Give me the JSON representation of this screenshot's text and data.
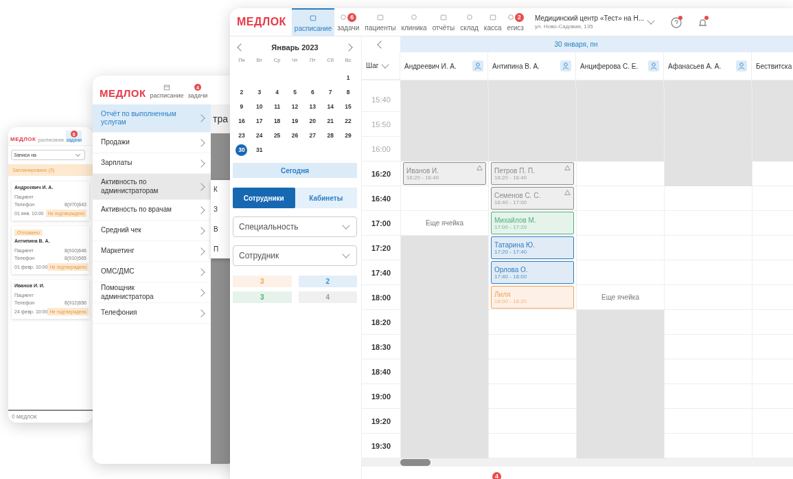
{
  "phone_window": {
    "logo": "МЕДЛОК",
    "tabs": [
      {
        "label": "расписание",
        "selected": false
      },
      {
        "label": "задачи",
        "selected": true,
        "badge": "6"
      }
    ],
    "filter": {
      "value": "Записи на"
    },
    "group": {
      "title": "Запланировано (3)"
    },
    "cards": [
      {
        "name": "Андреевич И. А.",
        "rows": [
          {
            "label": "Пациент"
          },
          {
            "label": "Телефон",
            "value": "8(970)643"
          }
        ],
        "date": "01 янв. 10:00",
        "status": "Не подтверждено"
      },
      {
        "name": "Антипина В. А.",
        "tag": "Отложено",
        "rows": [
          {
            "label": "Пациент",
            "value": "8(910)646"
          },
          {
            "label": "Телефон",
            "value": "8(910)565"
          }
        ],
        "date": "01 февр. 10:00",
        "status": "Не подтверждено"
      },
      {
        "name": "Иванов И. И.",
        "rows": [
          {
            "label": "Пациент"
          },
          {
            "label": "Телефон",
            "value": "8(912)656"
          }
        ],
        "date": "24 февр. 10:00",
        "status": "Не подтверждено"
      }
    ],
    "footer": "© МЕДЛОК"
  },
  "tablet_window": {
    "logo": "МЕДЛОК",
    "tabs": [
      {
        "label": "расписание",
        "selected": false
      },
      {
        "label": "задачи",
        "selected": false,
        "badge": "4"
      }
    ],
    "menu": [
      {
        "label": "Отчёт по выполненным услугам",
        "selected": true,
        "hovered": false
      },
      {
        "label": "Продажи",
        "selected": false,
        "hovered": false
      },
      {
        "label": "Зарплаты",
        "selected": false,
        "hovered": false
      },
      {
        "label": "Активность по администраторам",
        "selected": false,
        "hovered": true
      },
      {
        "label": "Активность по врачам",
        "selected": false,
        "hovered": false
      },
      {
        "label": "Средний чек",
        "selected": false,
        "hovered": false
      },
      {
        "label": "Маркетинг",
        "selected": false,
        "hovered": false
      },
      {
        "label": "ОМС/ДМС",
        "selected": false,
        "hovered": false
      },
      {
        "label": "Помощник администратора",
        "selected": false,
        "hovered": false
      },
      {
        "label": "Телефония",
        "selected": false,
        "hovered": false
      }
    ],
    "page_title": "тра",
    "submenu": [
      "К",
      "З",
      "В",
      "П"
    ]
  },
  "main_window": {
    "logo": "МЕДЛОК",
    "tabs": [
      {
        "label": "расписание",
        "selected": true
      },
      {
        "label": "задачи",
        "selected": false,
        "badge": "6"
      },
      {
        "label": "пациенты",
        "selected": false
      },
      {
        "label": "клиника",
        "selected": false
      },
      {
        "label": "отчёты",
        "selected": false
      },
      {
        "label": "склад",
        "selected": false
      },
      {
        "label": "касса",
        "selected": false
      },
      {
        "label": "егисз",
        "selected": false,
        "badge": "2"
      }
    ],
    "clinic": {
      "name": "Медицинский центр «Тест» на Н...",
      "address": "ул. Ново-Садовая, 135"
    },
    "help_alert": true,
    "notification_alert": true,
    "calendar": {
      "month": "Январь 2023",
      "weekdays": [
        "Пн",
        "Вт",
        "Ср",
        "Чт",
        "Пт",
        "Сб",
        "Вс"
      ],
      "weeks": [
        [
          {
            "day": "1",
            "selected": false
          }
        ],
        [
          {
            "day": "2",
            "selected": false
          },
          {
            "day": "3",
            "selected": false
          },
          {
            "day": "4",
            "selected": false
          },
          {
            "day": "5",
            "selected": false
          },
          {
            "day": "6",
            "selected": false
          },
          {
            "day": "7",
            "selected": false
          },
          {
            "day": "8",
            "selected": false
          }
        ],
        [
          {
            "day": "9",
            "selected": false
          },
          {
            "day": "10",
            "selected": false
          },
          {
            "day": "11",
            "selected": false
          },
          {
            "day": "12",
            "selected": false
          },
          {
            "day": "13",
            "selected": false
          },
          {
            "day": "14",
            "selected": false
          },
          {
            "day": "15",
            "selected": false
          }
        ],
        [
          {
            "day": "16",
            "selected": false
          },
          {
            "day": "17",
            "selected": false
          },
          {
            "day": "18",
            "selected": false
          },
          {
            "day": "19",
            "selected": false
          },
          {
            "day": "20",
            "selected": false
          },
          {
            "day": "21",
            "selected": false
          },
          {
            "day": "22",
            "selected": false
          }
        ],
        [
          {
            "day": "23",
            "selected": false
          },
          {
            "day": "24",
            "selected": false
          },
          {
            "day": "25",
            "selected": false
          },
          {
            "day": "26",
            "selected": false
          },
          {
            "day": "27",
            "selected": false
          },
          {
            "day": "28",
            "selected": false
          },
          {
            "day": "29",
            "selected": false
          }
        ],
        [
          {
            "day": "30",
            "selected": true
          },
          {
            "day": "31",
            "selected": false
          }
        ]
      ],
      "today_button": "Сегодня"
    },
    "view_toggle": [
      {
        "label": "Сотрудники",
        "selected": true
      },
      {
        "label": "Кабинеты",
        "selected": false
      }
    ],
    "filters": [
      {
        "placeholder": "Специальность"
      },
      {
        "placeholder": "Сотрудник"
      }
    ],
    "counters": [
      {
        "value": "3",
        "color": "#f0a35e"
      },
      {
        "value": "2",
        "color": "#3d8fd1"
      },
      {
        "value": "3",
        "color": "#4fb07a"
      },
      {
        "value": "4",
        "color": "#9a9a9a"
      }
    ],
    "schedule": {
      "date": "30 января, пн",
      "step_label": "Шаг",
      "doctors": [
        "Андреевич И. А.",
        "Антипина В. А.",
        "Анциферова С. Е.",
        "Афанасьев А. А.",
        "Бествитска"
      ],
      "rows": [
        {
          "time": "15:40",
          "past": true,
          "cells": [
            {
              "kind": "off"
            },
            {
              "kind": "off"
            },
            {
              "kind": "off"
            },
            {
              "kind": "off"
            },
            {
              "kind": "off"
            }
          ]
        },
        {
          "time": "15:50",
          "past": true,
          "cells": [
            {
              "kind": "off"
            },
            {
              "kind": "off"
            },
            {
              "kind": "off"
            },
            {
              "kind": "off"
            },
            {
              "kind": "off"
            }
          ]
        },
        {
          "time": "16:00",
          "past": true,
          "cells": [
            {
              "kind": "off"
            },
            {
              "kind": "off"
            },
            {
              "kind": "off"
            },
            {
              "kind": "off"
            },
            {
              "kind": "off"
            }
          ]
        },
        {
          "time": "16:20",
          "past": false,
          "cells": [
            {
              "kind": "appointment",
              "name": "Иванов И.",
              "time": "16:20 - 16:40",
              "color": "#8c8c8c",
              "warning": true
            },
            {
              "kind": "appointment",
              "name": "Петров П. П.",
              "time": "16:20 - 16:40",
              "color": "#8c8c8c",
              "warning": true
            },
            {
              "kind": "free"
            },
            {
              "kind": "off"
            },
            {
              "kind": "free"
            }
          ]
        },
        {
          "time": "16:40",
          "past": false,
          "cells": [
            {
              "kind": "free"
            },
            {
              "kind": "appointment",
              "name": "Семенов С. С.",
              "time": "16:40 - 17:00",
              "color": "#8c8c8c",
              "warning": true
            },
            {
              "kind": "free"
            },
            {
              "kind": "free"
            },
            {
              "kind": "free"
            }
          ]
        },
        {
          "time": "17:00",
          "past": false,
          "cells": [
            {
              "kind": "note",
              "text": "Еще ячейка"
            },
            {
              "kind": "appointment",
              "name": "Михайлов М.",
              "time": "17:00 - 17:20",
              "color": "#4fb07a",
              "warning": false
            },
            {
              "kind": "free"
            },
            {
              "kind": "free"
            },
            {
              "kind": "free"
            }
          ]
        },
        {
          "time": "17:20",
          "past": false,
          "cells": [
            {
              "kind": "off"
            },
            {
              "kind": "appointment",
              "name": "Татарина Ю.",
              "time": "17:20 - 17:40",
              "color": "#2f7cc0",
              "warning": false
            },
            {
              "kind": "free"
            },
            {
              "kind": "free"
            },
            {
              "kind": "free"
            }
          ]
        },
        {
          "time": "17:40",
          "past": false,
          "cells": [
            {
              "kind": "off"
            },
            {
              "kind": "appointment",
              "name": "Орлова О.",
              "time": "17:40 - 18:00",
              "color": "#2f7cc0",
              "warning": false
            },
            {
              "kind": "free"
            },
            {
              "kind": "free"
            },
            {
              "kind": "free"
            }
          ]
        },
        {
          "time": "18:00",
          "past": false,
          "cells": [
            {
              "kind": "off"
            },
            {
              "kind": "appointment",
              "name": "Лиля",
              "time": "18:00 - 18:20",
              "color": "#f0a35e",
              "warning": false
            },
            {
              "kind": "note",
              "text": "Еще ячейка"
            },
            {
              "kind": "free"
            },
            {
              "kind": "free"
            }
          ]
        },
        {
          "time": "18:20",
          "past": false,
          "cells": [
            {
              "kind": "off"
            },
            {
              "kind": "free"
            },
            {
              "kind": "off"
            },
            {
              "kind": "free"
            },
            {
              "kind": "free"
            }
          ]
        },
        {
          "time": "18:30",
          "past": false,
          "cells": [
            {
              "kind": "off"
            },
            {
              "kind": "free"
            },
            {
              "kind": "off"
            },
            {
              "kind": "free"
            },
            {
              "kind": "free"
            }
          ]
        },
        {
          "time": "18:40",
          "past": false,
          "cells": [
            {
              "kind": "off"
            },
            {
              "kind": "free"
            },
            {
              "kind": "off"
            },
            {
              "kind": "free"
            },
            {
              "kind": "free"
            }
          ]
        },
        {
          "time": "19:00",
          "past": false,
          "cells": [
            {
              "kind": "off"
            },
            {
              "kind": "free"
            },
            {
              "kind": "off"
            },
            {
              "kind": "free"
            },
            {
              "kind": "free"
            }
          ]
        },
        {
          "time": "19:20",
          "past": false,
          "cells": [
            {
              "kind": "off"
            },
            {
              "kind": "free"
            },
            {
              "kind": "off"
            },
            {
              "kind": "free"
            },
            {
              "kind": "free"
            }
          ]
        },
        {
          "time": "19:30",
          "past": false,
          "cells": [
            {
              "kind": "off"
            },
            {
              "kind": "free"
            },
            {
              "kind": "off"
            },
            {
              "kind": "free"
            },
            {
              "kind": "free"
            }
          ]
        }
      ]
    },
    "footer_badge": "4"
  }
}
